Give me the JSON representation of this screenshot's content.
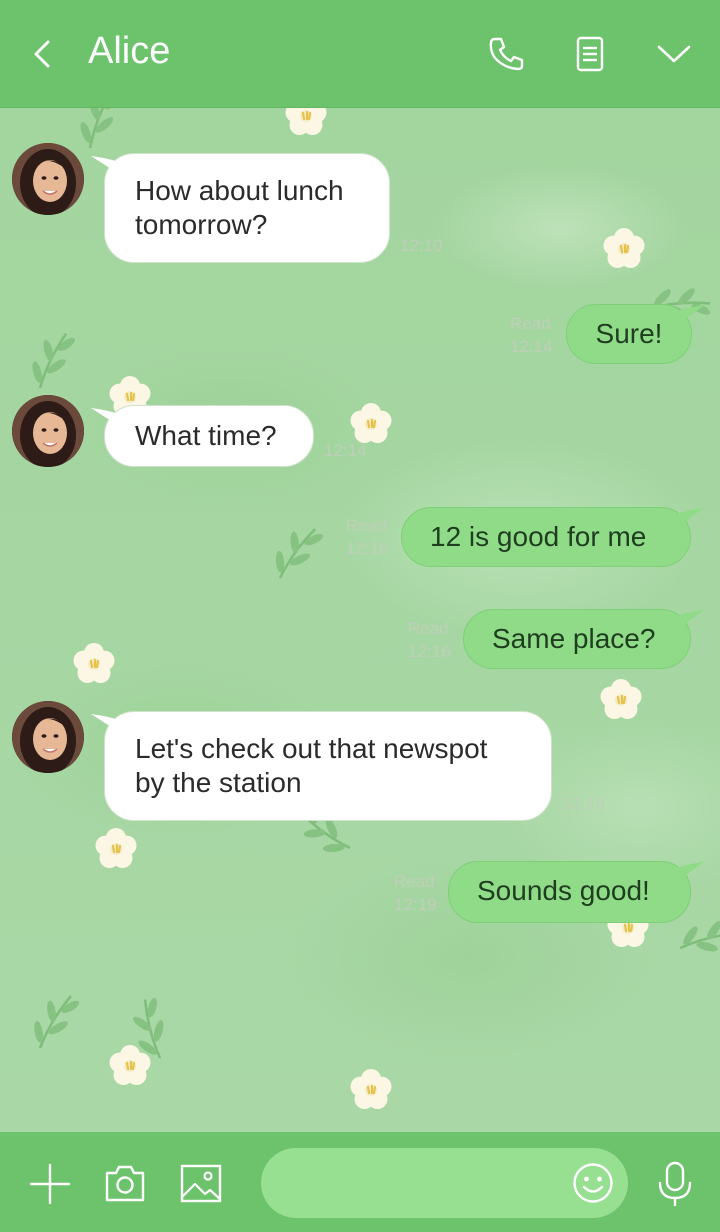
{
  "header": {
    "title": "Alice",
    "back_icon": "chevron-left-icon",
    "call_icon": "phone-icon",
    "notes_icon": "notes-icon",
    "menu_icon": "chevron-down-icon"
  },
  "colors": {
    "header_bg": "#6cc36b",
    "chat_bg": "#a9d8a6",
    "outgoing_bubble": "#8fdb88",
    "incoming_bubble": "#ffffff",
    "input_bg": "#97df91"
  },
  "messages": [
    {
      "direction": "in",
      "lines": [
        "How about lunch",
        "tomorrow?"
      ],
      "time": "12:10"
    },
    {
      "direction": "out",
      "text": "Sure!",
      "read": "Read",
      "time": "12:14"
    },
    {
      "direction": "in",
      "lines": [
        "What time?"
      ],
      "time": "12:14"
    },
    {
      "direction": "out",
      "text": "12 is good for me",
      "read": "Read",
      "time": "12:16"
    },
    {
      "direction": "out",
      "text": "Same place?",
      "read": "Read",
      "time": "12:16"
    },
    {
      "direction": "in",
      "lines": [
        "Let's check out that newspot",
        "by the station"
      ],
      "time": "12:19"
    },
    {
      "direction": "out",
      "text": "Sounds good!",
      "read": "Read",
      "time": "12:19"
    }
  ],
  "footer": {
    "add_icon": "plus-icon",
    "camera_icon": "camera-icon",
    "image_icon": "image-icon",
    "input_value": "",
    "emoji_icon": "smiley-icon",
    "mic_icon": "microphone-icon"
  }
}
